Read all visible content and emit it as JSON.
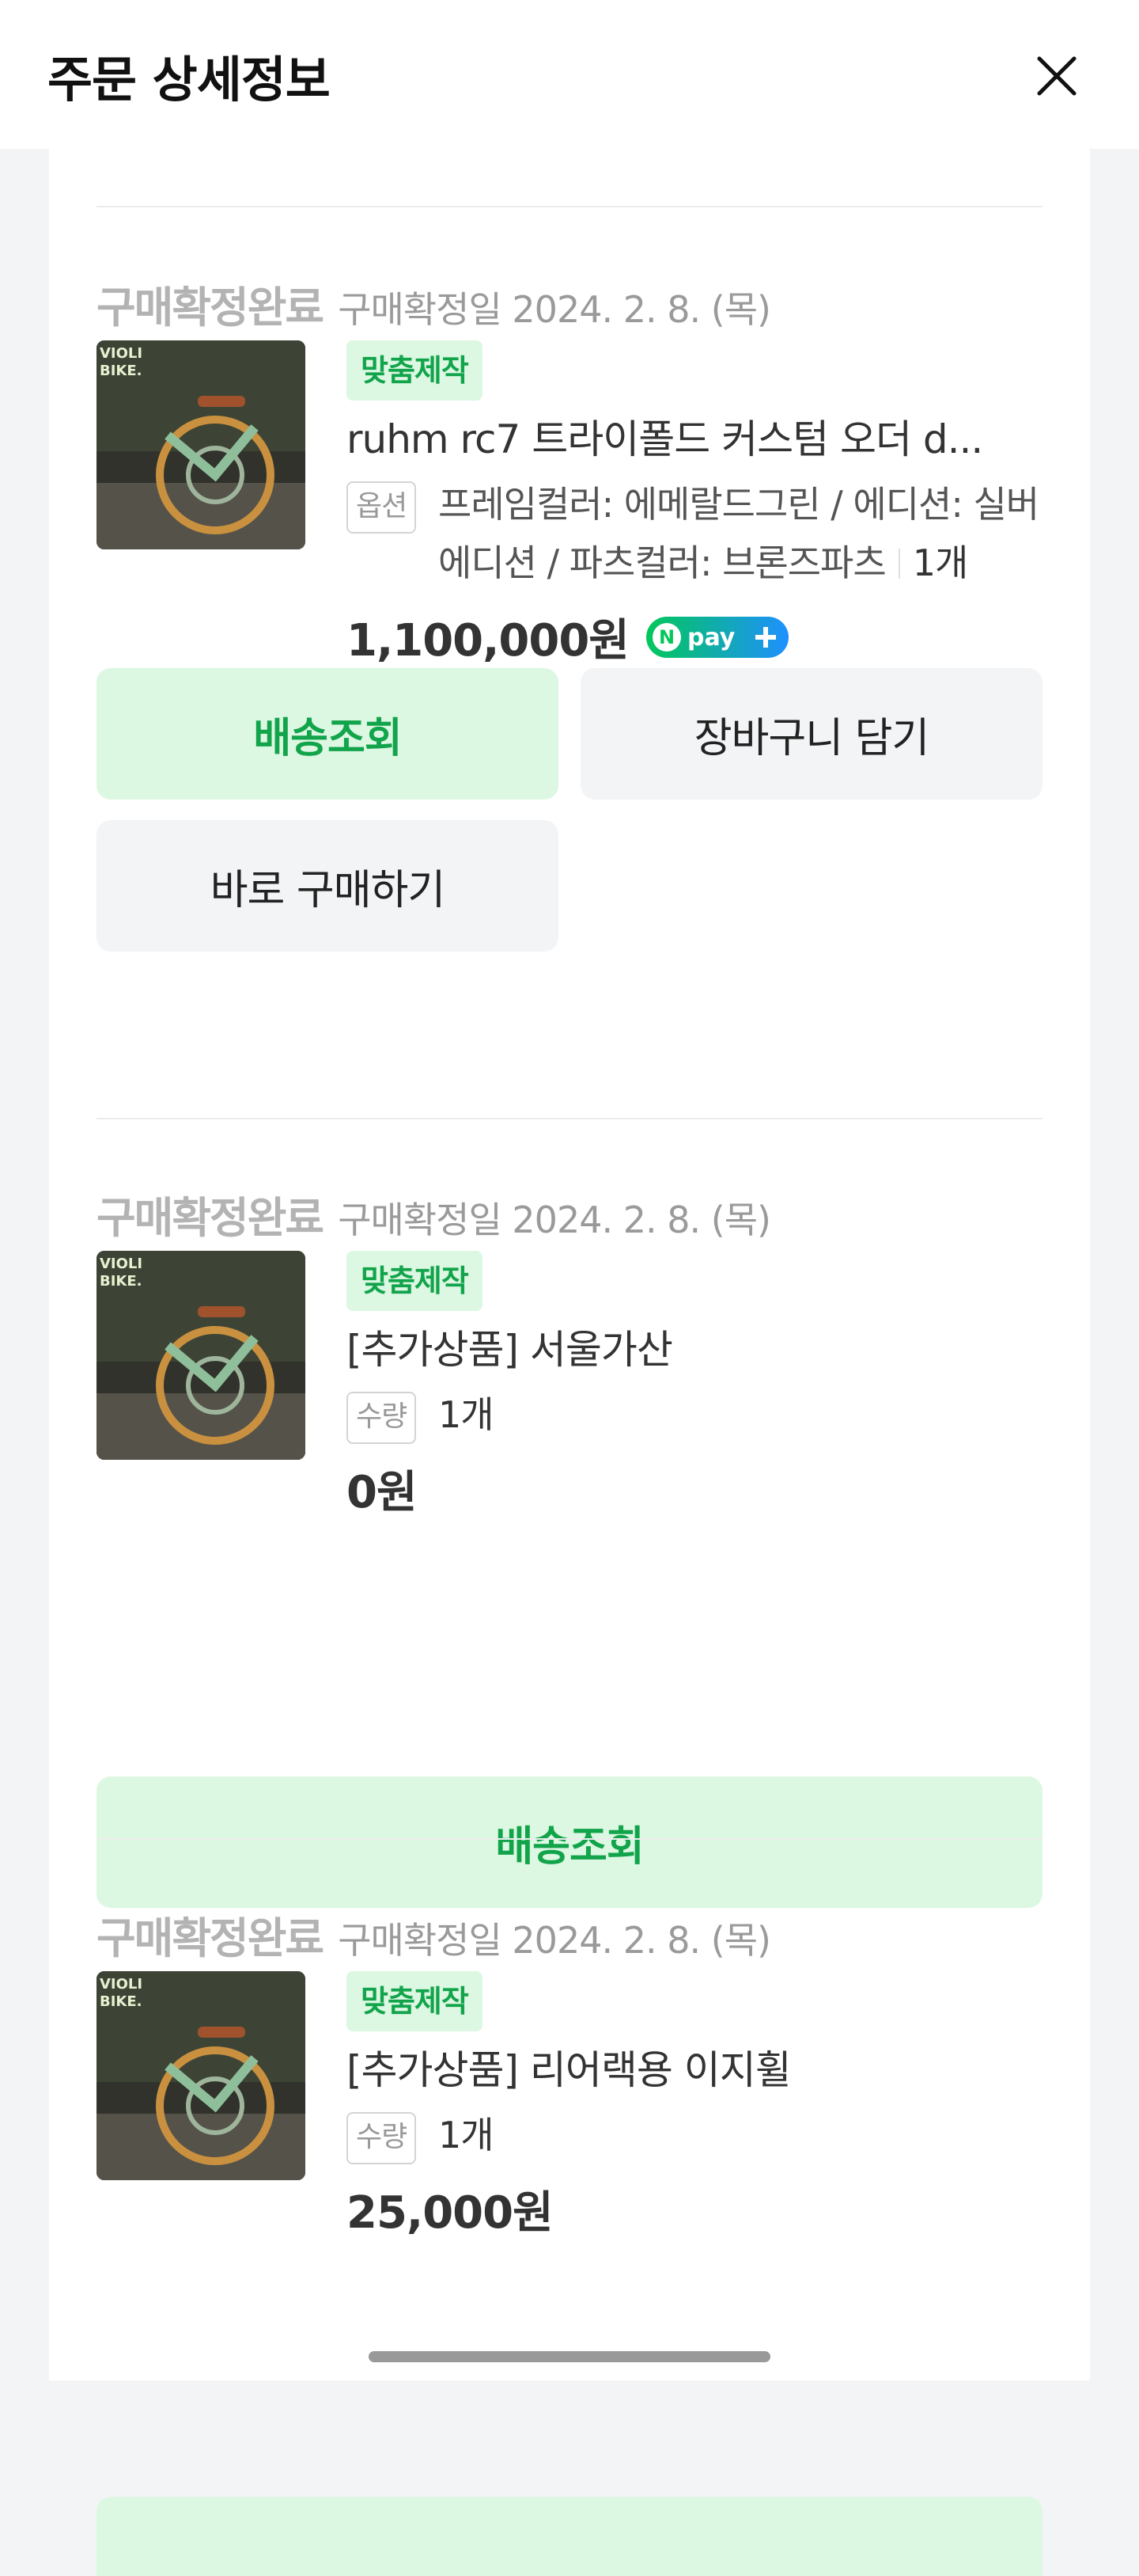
{
  "header": {
    "title": "주문 상세정보",
    "close_icon": "close-icon"
  },
  "orders": [
    {
      "status": "구매확정완료",
      "confirm_date": "구매확정일 2024. 2. 8. (목)",
      "badge": "맞춤제작",
      "product_name": "ruhm rc7 트라이폴드 커스텀 오더 d...",
      "option_tag": "옵션",
      "option_text": "프레임컬러: 에메랄드그린 / 에디션: 실버에디션 / 파츠컬러: 브론즈파츠",
      "quantity": "1개",
      "price": "1,100,000원",
      "pay_badge": "Npay+",
      "buttons": {
        "track": "배송조회",
        "cart": "장바구니 담기",
        "buy_now": "바로 구매하기"
      }
    },
    {
      "status": "구매확정완료",
      "confirm_date": "구매확정일 2024. 2. 8. (목)",
      "badge": "맞춤제작",
      "product_name": "[추가상품] 서울가산",
      "qty_tag": "수량",
      "quantity": "1개",
      "price": "0원",
      "buttons": {
        "track": "배송조회"
      }
    },
    {
      "status": "구매확정완료",
      "confirm_date": "구매확정일 2024. 2. 8. (목)",
      "badge": "맞춤제작",
      "product_name": "[추가상품] 리어랙용 이지휠",
      "qty_tag": "수량",
      "quantity": "1개",
      "price": "25,000원"
    }
  ],
  "thumbnail_text": {
    "line1": "VIOLI",
    "line2": "BIKE."
  },
  "colors": {
    "accent_green": "#12a44b",
    "badge_bg": "#dcf7e2",
    "npay_green": "#03c75a",
    "npay_blue": "#1e90ff"
  }
}
